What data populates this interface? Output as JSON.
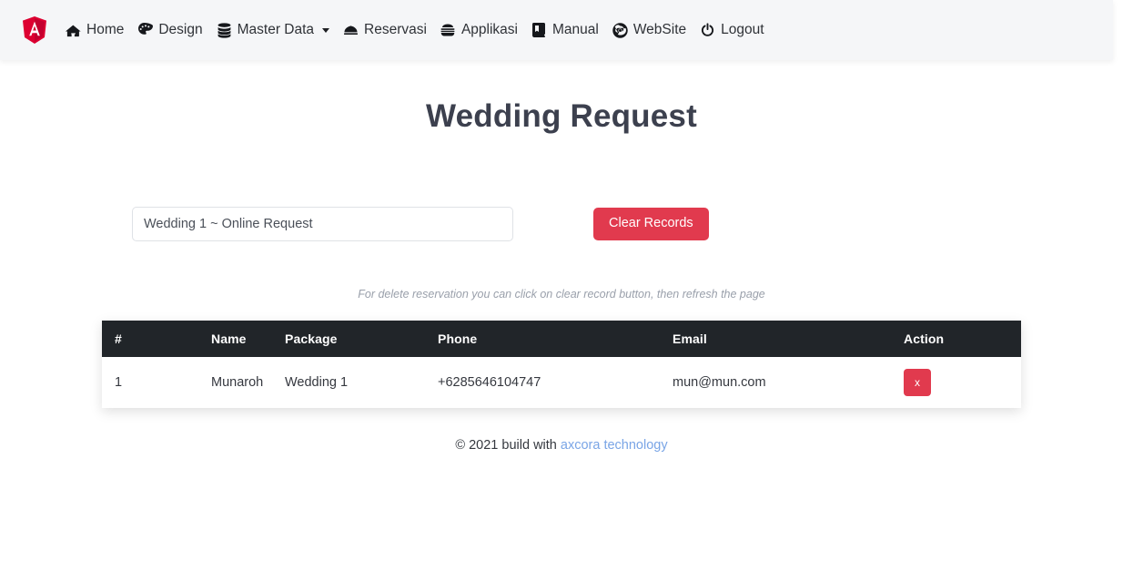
{
  "navbar": {
    "brand_icon": "angular-shield-logo",
    "brand_color": "#dd0031",
    "items": [
      {
        "label": "Home",
        "icon": "home-icon",
        "has_caret": false
      },
      {
        "label": "Design",
        "icon": "palette-icon",
        "has_caret": false
      },
      {
        "label": "Master Data",
        "icon": "database-icon",
        "has_caret": true
      },
      {
        "label": "Reservasi",
        "icon": "bell-desk-icon",
        "has_caret": false
      },
      {
        "label": "Applikasi",
        "icon": "burger-icon",
        "has_caret": false
      },
      {
        "label": "Manual",
        "icon": "book-icon",
        "has_caret": false
      },
      {
        "label": "WebSite",
        "icon": "chrome-icon",
        "has_caret": false
      },
      {
        "label": "Logout",
        "icon": "power-icon",
        "has_caret": false
      }
    ]
  },
  "main": {
    "title": "Wedding Request",
    "package_select": {
      "value": "Wedding 1 ~ Online Request",
      "placeholder": "Wedding 1 ~ Online Request"
    },
    "clear_button": "Clear Records",
    "hint": "For delete reservation you can click on clear record button, then refresh the page",
    "accent_color": "#e13a4e"
  },
  "table": {
    "headers": [
      "#",
      "Name",
      "Package",
      "Phone",
      "Email",
      "Action"
    ],
    "rows": [
      {
        "num": "1",
        "name": "Munaroh",
        "package": "Wedding 1",
        "phone": "+6285646104747",
        "email": "mun@mun.com",
        "action_label": "x"
      }
    ]
  },
  "footer": {
    "text": "© 2021 build with",
    "link": "axcora technology"
  }
}
